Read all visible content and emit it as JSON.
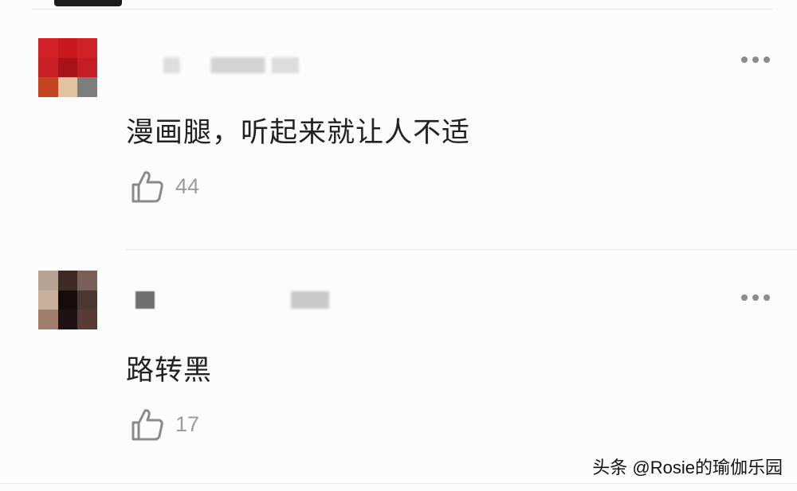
{
  "comments": [
    {
      "text": "漫画腿，听起来就让人不适",
      "like_count": "44",
      "like_icon": "thumbs-up-icon",
      "more_icon": "more-dots-icon"
    },
    {
      "text": "路转黑",
      "like_count": "17",
      "like_icon": "thumbs-up-icon",
      "more_icon": "more-dots-icon"
    }
  ],
  "watermark": "头条 @Rosie的瑜伽乐园",
  "colors": {
    "text": "#222222",
    "count": "#9c9c9c",
    "divider": "#e3e3e3"
  }
}
